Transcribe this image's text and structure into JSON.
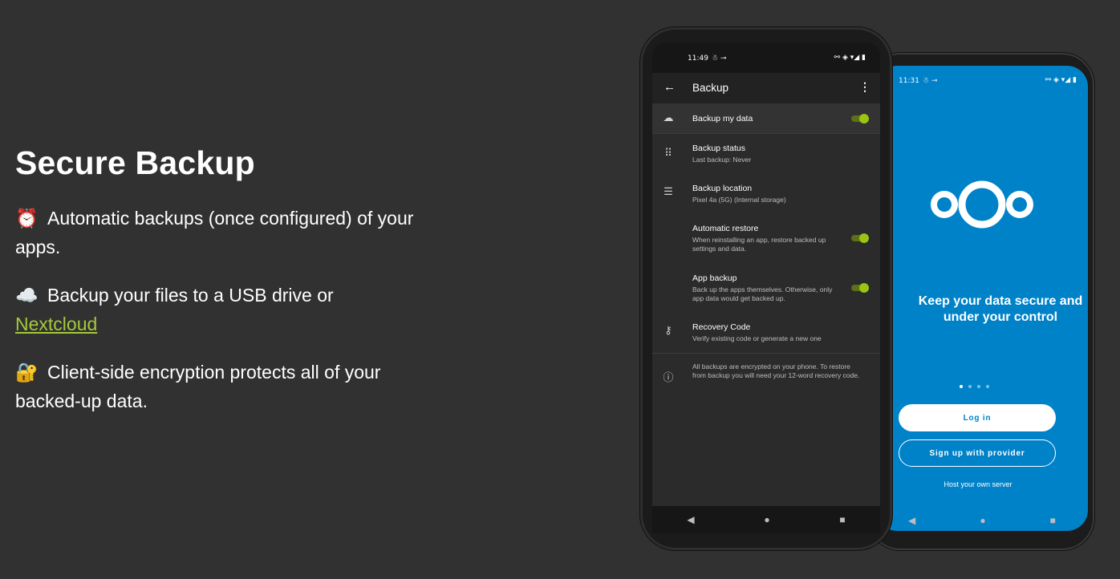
{
  "left": {
    "title": "Secure Backup",
    "features": [
      {
        "emoji": "⏰",
        "text": "Automatic backups (once configured) of your apps."
      },
      {
        "emoji": "☁️",
        "text_before": "Backup your files to a USB drive or",
        "link": "Nextcloud"
      },
      {
        "emoji": "🔐",
        "text": "Client-side encryption protects all of your backed-up data."
      }
    ],
    "link_color": "#a6c93b"
  },
  "phone_front": {
    "status_time": "11:49",
    "status_left_icons": "☃ ⊸",
    "status_right_icons": "⚯ ◈ ▾◢ ▮",
    "appbar": {
      "back_icon": "←",
      "title": "Backup",
      "more_icon": "⋮"
    },
    "rows": [
      {
        "icon": "cloud-upload-icon",
        "glyph": "☁",
        "title": "Backup my data",
        "toggle": true
      },
      {
        "icon": "apps-grid-icon",
        "glyph": "⠿",
        "title": "Backup status",
        "subtitle": "Last backup: Never"
      },
      {
        "icon": "storage-icon",
        "glyph": "☰",
        "title": "Backup location",
        "subtitle": "Pixel 4a (5G) (Internal storage)"
      },
      {
        "title": "Automatic restore",
        "subtitle": "When reinstalling an app, restore backed up settings and data.",
        "toggle": true
      },
      {
        "title": "App backup",
        "subtitle": "Back up the apps themselves. Otherwise, only app data would get backed up.",
        "toggle": true
      },
      {
        "icon": "key-icon",
        "glyph": "⚷",
        "title": "Recovery Code",
        "subtitle": "Verify existing code or generate a new one"
      },
      {
        "icon": "info-icon",
        "glyph": "ⓘ",
        "subtitle": "All backups are encrypted on your phone. To restore from backup you will need your 12-word recovery code."
      }
    ],
    "accent": "#9ac513"
  },
  "phone_back": {
    "status_time": "11:31",
    "status_left_icons": "☃ ⊸",
    "status_right_icons": "⚯ ◈ ▾◢ ▮",
    "headline": "Keep your data secure and under your control",
    "login_label": "Log in",
    "signup_label": "Sign up with provider",
    "host_label": "Host your own server",
    "brand_color": "#0082c9"
  },
  "nav": {
    "back": "◀",
    "home": "●",
    "recents": "■"
  }
}
